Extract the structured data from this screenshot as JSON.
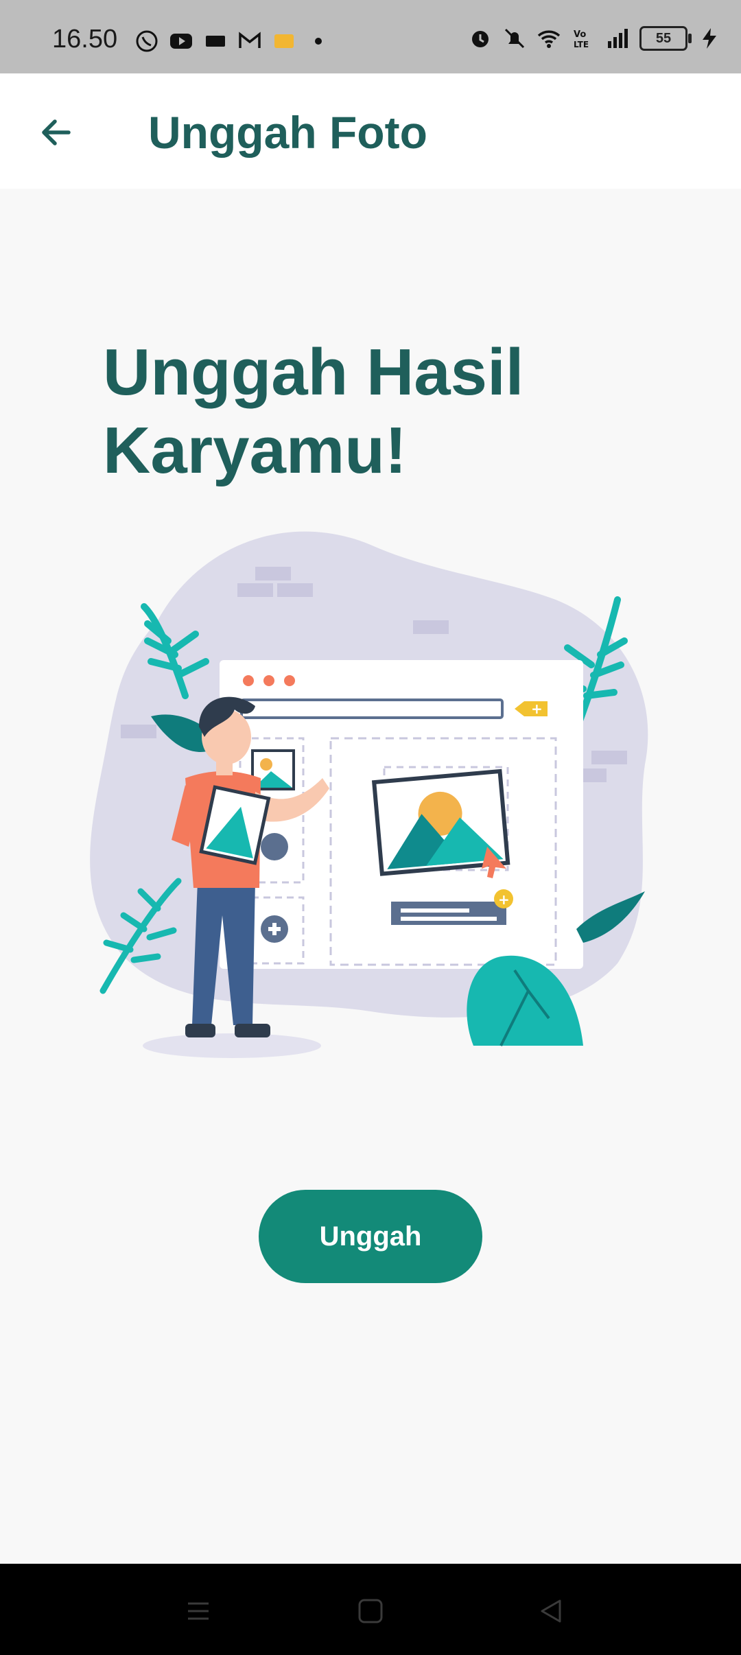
{
  "status_bar": {
    "time": "16.50",
    "battery_level": "55",
    "left_icons": [
      "whatsapp-icon",
      "youtube-icon",
      "ticket-icon",
      "gmail-icon",
      "yellow-app-icon",
      "dot-icon"
    ],
    "right_icons": [
      "alarm-icon",
      "mute-icon",
      "wifi-icon",
      "volte-icon",
      "signal-icon",
      "battery-icon",
      "charging-icon"
    ]
  },
  "app_bar": {
    "title": "Unggah Foto",
    "back_icon": "arrow-left-icon"
  },
  "main": {
    "headline_line1": "Unggah Hasil",
    "headline_line2": "Karyamu!",
    "illustration": "person-uploading-photo-illustration",
    "upload_button_label": "Unggah"
  },
  "nav_bar": {
    "icons": [
      "menu-icon",
      "home-square-icon",
      "back-triangle-icon"
    ]
  },
  "colors": {
    "primary_dark": "#1f5f5b",
    "button": "#138a78",
    "accent_teal": "#17b8b0",
    "accent_orange": "#f47a5c",
    "blob": "#dcdbea"
  }
}
